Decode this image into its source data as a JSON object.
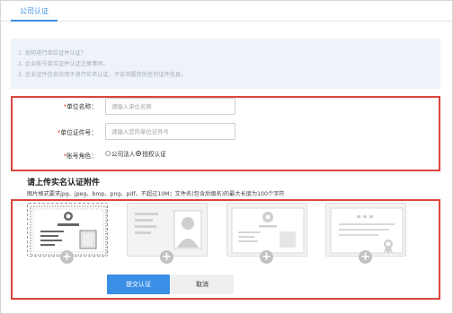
{
  "tab": {
    "label": "公司认证"
  },
  "notice": [
    "1. 如何进行单位证件认证？",
    "2. 企业账号单位证件认证注意事项。",
    "3. 企业证件信息仅用于进行实名认证，不会泄露您的任何证件信息。"
  ],
  "form": {
    "name_label": "单位名称：",
    "name_placeholder": "请输入单位名称",
    "license_label": "单位证件号：",
    "license_placeholder": "请输入您的单位证件号",
    "role_label": "账号角色：",
    "role_options": [
      "公司法人",
      "授权认证"
    ],
    "role_selected": "授权认证",
    "required_mark": "*"
  },
  "upload": {
    "title": "请上传实名认证附件",
    "hint": "图片格式要求jpg、jpeg、bmp、png、pdf，不超过10M；文件名(包含后缀名)的最大长度为100个字符",
    "plus": "+"
  },
  "buttons": {
    "submit": "提交认证",
    "cancel": "取消"
  },
  "colors": {
    "accent": "#3a8ee6",
    "highlight": "#d9453d",
    "notice_bg": "#eef3fa"
  }
}
